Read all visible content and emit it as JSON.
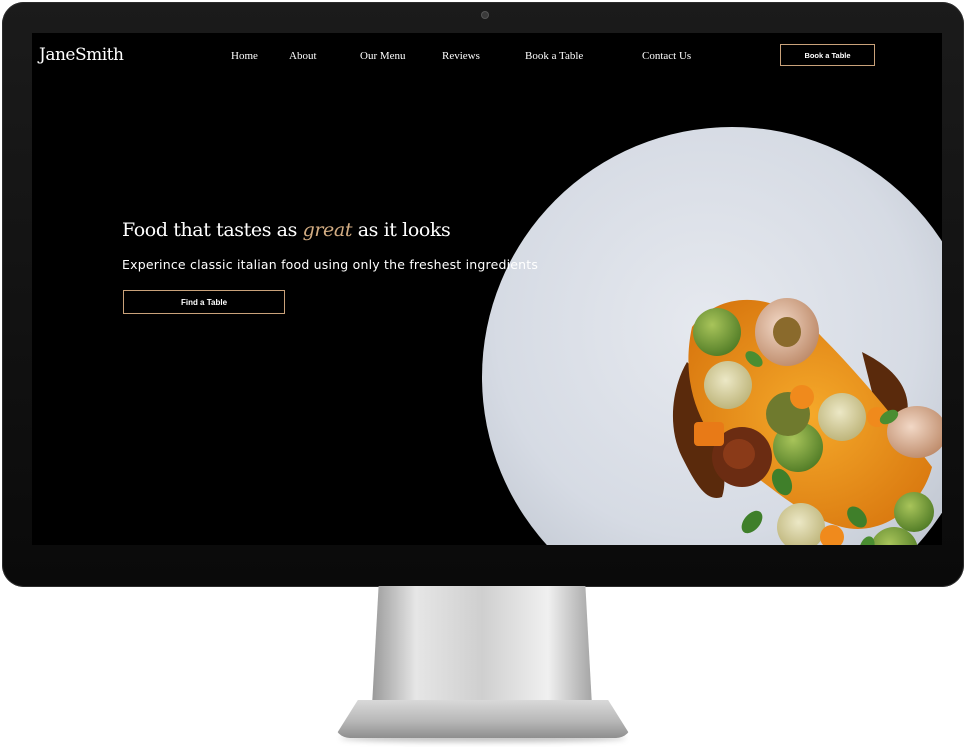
{
  "site": {
    "logo": "JaneSmith"
  },
  "nav": {
    "items": [
      {
        "label": "Home"
      },
      {
        "label": "About"
      },
      {
        "label": "Our Menu"
      },
      {
        "label": "Reviews"
      },
      {
        "label": "Book a Table"
      },
      {
        "label": "Contact Us"
      }
    ],
    "cta_label": "Book a Table"
  },
  "hero": {
    "title_before": "Food that tastes as ",
    "title_emphasis": "great",
    "title_after": " as it looks",
    "subtitle": "Experince classic italian food using only the freshest ingredients",
    "cta_label": "Find a Table",
    "image_icon": "plated-dish-image"
  },
  "colors": {
    "accent": "#c9a27a",
    "emphasis_text": "#d3ad83",
    "background": "#000000",
    "text": "#ffffff",
    "plate": "#d8dde6"
  }
}
